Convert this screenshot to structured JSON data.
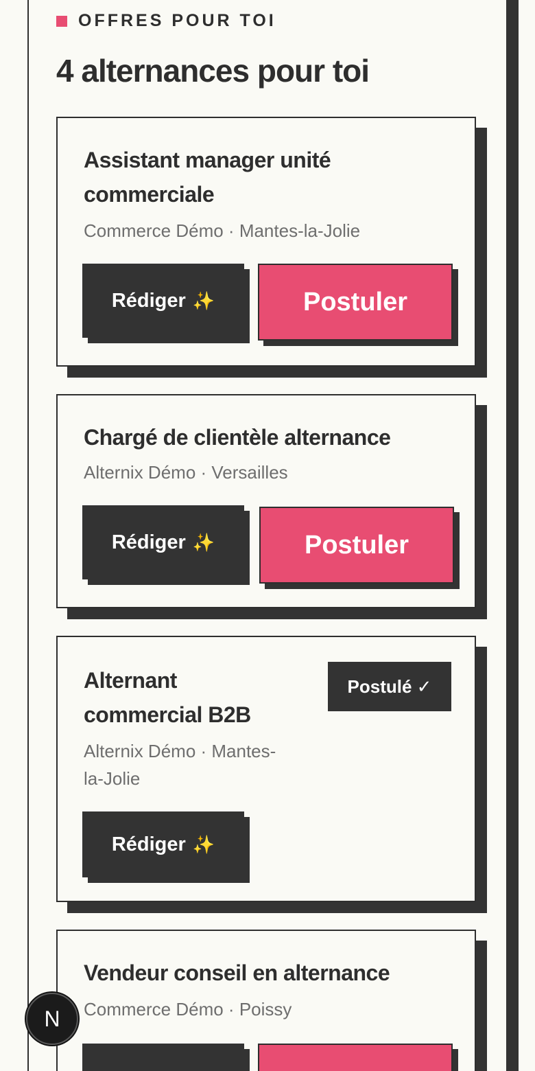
{
  "section": {
    "label": "OFFRES POUR TOI",
    "title": "4 alternances pour toi"
  },
  "offers": [
    {
      "title_line1": "Assistant manager unité",
      "title_line2": "commerciale",
      "company_location": "Commerce Démo · Mantes-la-Jolie",
      "draft_label": "Rédiger",
      "apply_label": "Postuler"
    },
    {
      "title_line1": "Chargé de clientèle alternance",
      "company_location": "Alternix Démo · Versailles",
      "draft_label": "Rédiger",
      "apply_label": "Postuler"
    },
    {
      "title_line1": "Alternant",
      "title_line2": "commercial B2B",
      "company_location_line1": "Alternix Démo · Mantes-",
      "company_location_line2": "la-Jolie",
      "applied_label": "Postulé ✓",
      "draft_label": "Rédiger"
    },
    {
      "title_line1": "Vendeur conseil en alternance",
      "company_location": "Commerce Démo · Poissy"
    }
  ],
  "icons": {
    "sparkle": "✨",
    "fab_letter": "N"
  },
  "colors": {
    "accent_pink": "#e84d72",
    "dark": "#333333",
    "background": "#fafaf5"
  }
}
